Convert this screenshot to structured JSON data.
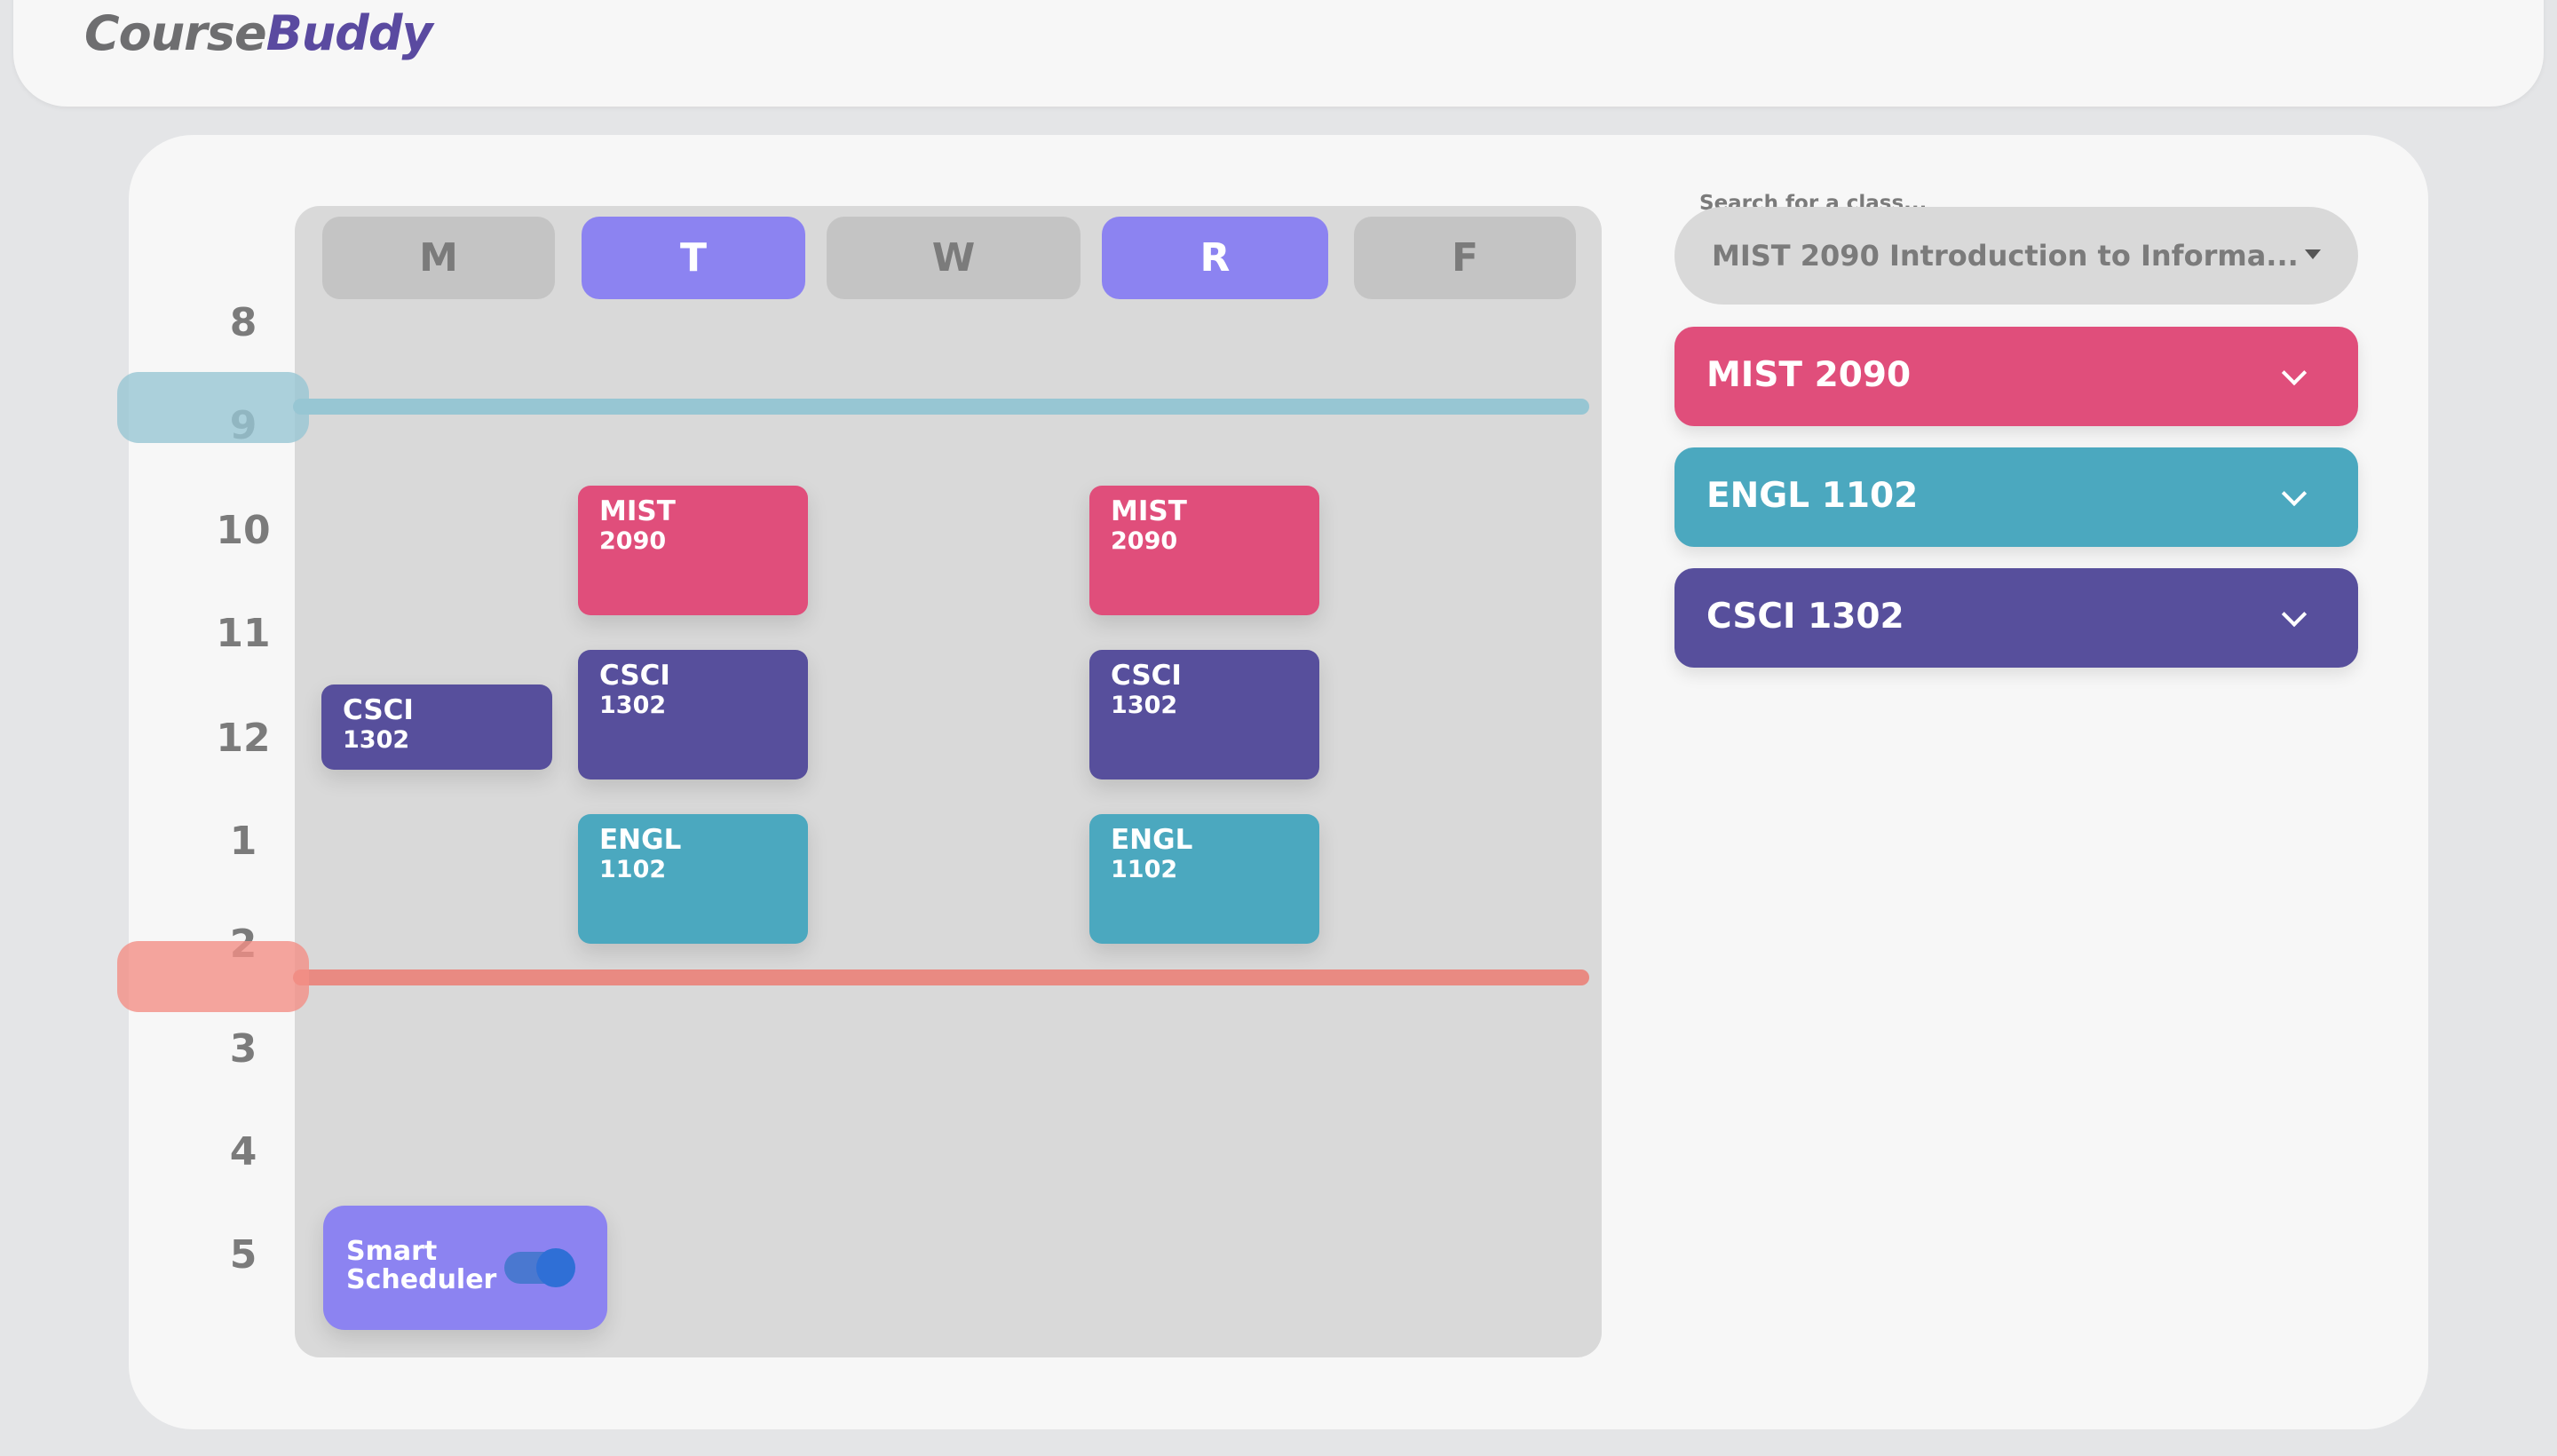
{
  "app": {
    "logo_part1": "Course",
    "logo_part2": "Buddy"
  },
  "schedule": {
    "days": [
      "M",
      "T",
      "W",
      "R",
      "F"
    ],
    "active_days": [
      "T",
      "R"
    ],
    "hours": [
      "8",
      "9",
      "10",
      "11",
      "12",
      "1",
      "2",
      "3",
      "4",
      "5"
    ],
    "start_time_marker": "9",
    "end_time_marker": "2",
    "blocks": [
      {
        "day": "M",
        "dept": "CSCI",
        "num": "1302"
      },
      {
        "day": "T",
        "dept": "MIST",
        "num": "2090"
      },
      {
        "day": "T",
        "dept": "CSCI",
        "num": "1302"
      },
      {
        "day": "T",
        "dept": "ENGL",
        "num": "1102"
      },
      {
        "day": "R",
        "dept": "MIST",
        "num": "2090"
      },
      {
        "day": "R",
        "dept": "CSCI",
        "num": "1302"
      },
      {
        "day": "R",
        "dept": "ENGL",
        "num": "1102"
      }
    ],
    "smart_scheduler": {
      "label_line1": "Smart",
      "label_line2": "Scheduler",
      "enabled": true
    }
  },
  "search": {
    "label": "Search for a class...",
    "value": "MIST 2090 Introduction to Informa..."
  },
  "courses": [
    {
      "name": "MIST 2090",
      "color": "#e04e7b"
    },
    {
      "name": "ENGL 1102",
      "color": "#4ba8bf"
    },
    {
      "name": "CSCI 1302",
      "color": "#574f9c"
    }
  ],
  "colors": {
    "accent": "#8c83f1",
    "start_line": "#97c6d3",
    "end_line": "#e98a82"
  }
}
